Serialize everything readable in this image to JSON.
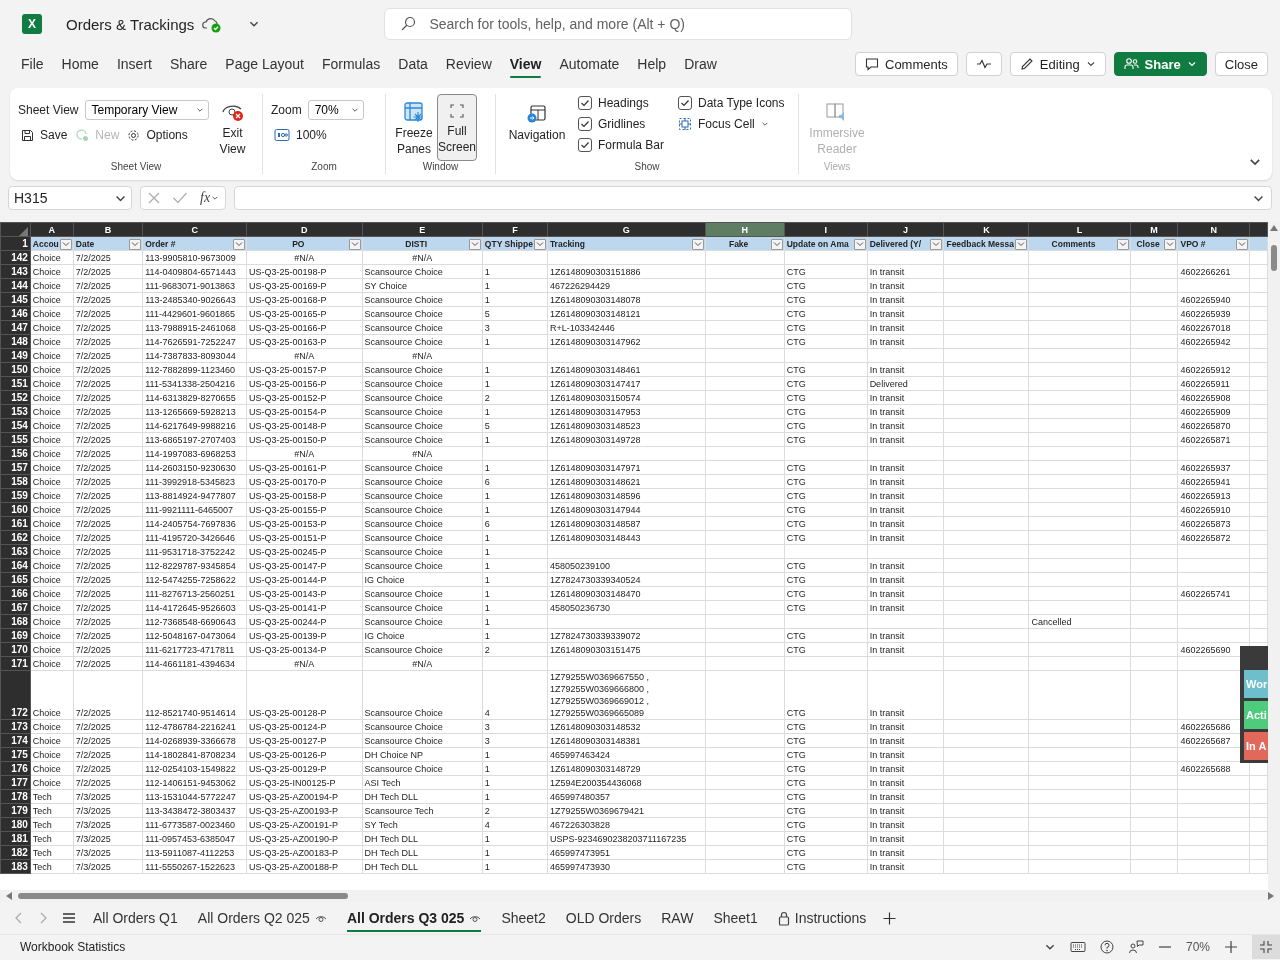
{
  "app": {
    "logo": "X",
    "title": "Orders & Trackings",
    "search": {
      "placeholder": "Search for tools, help, and more (Alt + Q)"
    }
  },
  "menu": [
    {
      "label": "File",
      "selected": false
    },
    {
      "label": "Home",
      "selected": false
    },
    {
      "label": "Insert",
      "selected": false
    },
    {
      "label": "Share",
      "selected": false
    },
    {
      "label": "Page Layout",
      "selected": false
    },
    {
      "label": "Formulas",
      "selected": false
    },
    {
      "label": "Data",
      "selected": false
    },
    {
      "label": "Review",
      "selected": false
    },
    {
      "label": "View",
      "selected": true
    },
    {
      "label": "Automate",
      "selected": false
    },
    {
      "label": "Help",
      "selected": false
    },
    {
      "label": "Draw",
      "selected": false
    }
  ],
  "actions": {
    "comments": "Comments",
    "editing": "Editing",
    "share": "Share",
    "close": "Close"
  },
  "ribbon": {
    "sheet_view": {
      "label": "Sheet View",
      "view": "Temporary View",
      "exit": "Exit View",
      "save": "Save",
      "new": {
        "label": "New",
        "disabled": true
      },
      "options": "Options",
      "group": "Sheet View"
    },
    "zoom": {
      "label": "Zoom",
      "value": "70%",
      "reset": "100%",
      "group": "Zoom"
    },
    "window": {
      "freeze": "Freeze Panes",
      "full_screen": {
        "label": "Full Screen",
        "pressed": true
      },
      "group": "Window"
    },
    "show": {
      "navigation": "Navigation",
      "checks": [
        {
          "label": "Headings",
          "checked": true
        },
        {
          "label": "Gridlines",
          "checked": true
        },
        {
          "label": "Formula Bar",
          "checked": true
        },
        {
          "label": "Data Type Icons",
          "checked": true
        }
      ],
      "focus_cell": "Focus Cell",
      "group": "Show"
    },
    "views": {
      "immersive": {
        "label": "Immersive Reader",
        "disabled": true
      },
      "group": "Views"
    }
  },
  "formula_bar": {
    "name_box": "H315",
    "function_label": "fx"
  },
  "sheet": {
    "header_row": "1",
    "columns": [
      {
        "letter": "A",
        "header": "Accou",
        "selected": false
      },
      {
        "letter": "B",
        "header": "Date",
        "selected": false
      },
      {
        "letter": "C",
        "header": "Order #",
        "selected": false
      },
      {
        "letter": "D",
        "header": "PO",
        "selected": false
      },
      {
        "letter": "E",
        "header": "DISTI",
        "selected": false
      },
      {
        "letter": "F",
        "header": "QTY Shippe",
        "selected": false
      },
      {
        "letter": "G",
        "header": "Tracking",
        "selected": false
      },
      {
        "letter": "H",
        "header": "Fake",
        "selected": true
      },
      {
        "letter": "I",
        "header": "Update on Ama",
        "selected": false
      },
      {
        "letter": "J",
        "header": "Delivered (Y/",
        "selected": false
      },
      {
        "letter": "K",
        "header": "Feedback Messa",
        "selected": false
      },
      {
        "letter": "L",
        "header": "Comments",
        "selected": false
      },
      {
        "letter": "M",
        "header": "Close",
        "selected": false
      },
      {
        "letter": "N",
        "header": "VPO #",
        "selected": false
      }
    ],
    "rows": [
      {
        "row": "142",
        "account": "Choice",
        "date": "7/2/2025",
        "order": "113-9905810-9673009",
        "po": "#N/A",
        "disti": "#N/A",
        "error": true
      },
      {
        "row": "143",
        "account": "Choice",
        "date": "7/2/2025",
        "order": "114-0409804-6571443",
        "po": "US-Q3-25-00198-P",
        "disti": "Scansource Choice",
        "qty": "1",
        "tracking": "1Z6148090303151886",
        "update": "CTG",
        "delivered": "In transit",
        "vpo": "4602266261"
      },
      {
        "row": "144",
        "account": "Choice",
        "date": "7/2/2025",
        "order": "111-9683071-9013863",
        "po": "US-Q3-25-00169-P",
        "disti": "SY Choice",
        "qty": "1",
        "tracking": "467226294429",
        "update": "CTG",
        "delivered": "In transit"
      },
      {
        "row": "145",
        "account": "Choice",
        "date": "7/2/2025",
        "order": "113-2485340-9026643",
        "po": "US-Q3-25-00168-P",
        "disti": "Scansource Choice",
        "qty": "1",
        "tracking": "1Z6148090303148078",
        "update": "CTG",
        "delivered": "In transit",
        "vpo": "4602265940"
      },
      {
        "row": "146",
        "account": "Choice",
        "date": "7/2/2025",
        "order": "111-4429601-9601865",
        "po": "US-Q3-25-00165-P",
        "disti": "Scansource Choice",
        "qty": "5",
        "tracking": "1Z6148090303148121",
        "update": "CTG",
        "delivered": "In transit",
        "vpo": "4602265939"
      },
      {
        "row": "147",
        "account": "Choice",
        "date": "7/2/2025",
        "order": "113-7988915-2461068",
        "po": "US-Q3-25-00166-P",
        "disti": "Scansource Choice",
        "qty": "3",
        "tracking": "R+L-103342446",
        "update": "CTG",
        "delivered": "In transit",
        "vpo": "4602267018"
      },
      {
        "row": "148",
        "account": "Choice",
        "date": "7/2/2025",
        "order": "114-7626591-7252247",
        "po": "US-Q3-25-00163-P",
        "disti": "Scansource Choice",
        "qty": "1",
        "tracking": "1Z6148090303147962",
        "update": "CTG",
        "delivered": "In transit",
        "vpo": "4602265942"
      },
      {
        "row": "149",
        "account": "Choice",
        "date": "7/2/2025",
        "order": "114-7387833-8093044",
        "po": "#N/A",
        "disti": "#N/A",
        "error": true
      },
      {
        "row": "150",
        "account": "Choice",
        "date": "7/2/2025",
        "order": "112-7882899-1123460",
        "po": "US-Q3-25-00157-P",
        "disti": "Scansource Choice",
        "qty": "1",
        "tracking": "1Z6148090303148461",
        "update": "CTG",
        "delivered": "In transit",
        "vpo": "4602265912"
      },
      {
        "row": "151",
        "account": "Choice",
        "date": "7/2/2025",
        "order": "111-5341338-2504216",
        "po": "US-Q3-25-00156-P",
        "disti": "Scansource Choice",
        "qty": "1",
        "tracking": "1Z6148090303147417",
        "update": "CTG",
        "delivered": "Delivered",
        "vpo": "4602265911"
      },
      {
        "row": "152",
        "account": "Choice",
        "date": "7/2/2025",
        "order": "114-6313829-8270655",
        "po": "US-Q3-25-00152-P",
        "disti": "Scansource Choice",
        "qty": "2",
        "tracking": "1Z6148090303150574",
        "update": "CTG",
        "delivered": "In transit",
        "vpo": "4602265908"
      },
      {
        "row": "153",
        "account": "Choice",
        "date": "7/2/2025",
        "order": "113-1265669-5928213",
        "po": "US-Q3-25-00154-P",
        "disti": "Scansource Choice",
        "qty": "1",
        "tracking": "1Z6148090303147953",
        "update": "CTG",
        "delivered": "In transit",
        "vpo": "4602265909"
      },
      {
        "row": "154",
        "account": "Choice",
        "date": "7/2/2025",
        "order": "114-6217649-9988216",
        "po": "US-Q3-25-00148-P",
        "disti": "Scansource Choice",
        "qty": "5",
        "tracking": "1Z6148090303148523",
        "update": "CTG",
        "delivered": "In transit",
        "vpo": "4602265870"
      },
      {
        "row": "155",
        "account": "Choice",
        "date": "7/2/2025",
        "order": "113-6865197-2707403",
        "po": "US-Q3-25-00150-P",
        "disti": "Scansource Choice",
        "qty": "1",
        "tracking": "1Z6148090303149728",
        "update": "CTG",
        "delivered": "In transit",
        "vpo": "4602265871"
      },
      {
        "row": "156",
        "account": "Choice",
        "date": "7/2/2025",
        "order": "114-1997083-6968253",
        "po": "#N/A",
        "disti": "#N/A",
        "error": true
      },
      {
        "row": "157",
        "account": "Choice",
        "date": "7/2/2025",
        "order": "114-2603150-9230630",
        "po": "US-Q3-25-00161-P",
        "disti": "Scansource Choice",
        "qty": "1",
        "tracking": "1Z6148090303147971",
        "update": "CTG",
        "delivered": "In transit",
        "vpo": "4602265937"
      },
      {
        "row": "158",
        "account": "Choice",
        "date": "7/2/2025",
        "order": "111-3992918-5345823",
        "po": "US-Q3-25-00170-P",
        "disti": "Scansource Choice",
        "qty": "6",
        "tracking": "1Z6148090303148621",
        "update": "CTG",
        "delivered": "In transit",
        "vpo": "4602265941"
      },
      {
        "row": "159",
        "account": "Choice",
        "date": "7/2/2025",
        "order": "113-8814924-9477807",
        "po": "US-Q3-25-00158-P",
        "disti": "Scansource Choice",
        "qty": "1",
        "tracking": "1Z6148090303148596",
        "update": "CTG",
        "delivered": "In transit",
        "vpo": "4602265913"
      },
      {
        "row": "160",
        "account": "Choice",
        "date": "7/2/2025",
        "order": "111-9921111-6465007",
        "po": "US-Q3-25-00155-P",
        "disti": "Scansource Choice",
        "qty": "1",
        "tracking": "1Z6148090303147944",
        "update": "CTG",
        "delivered": "In transit",
        "vpo": "4602265910"
      },
      {
        "row": "161",
        "account": "Choice",
        "date": "7/2/2025",
        "order": "114-2405754-7697836",
        "po": "US-Q3-25-00153-P",
        "disti": "Scansource Choice",
        "qty": "6",
        "tracking": "1Z6148090303148587",
        "update": "CTG",
        "delivered": "In transit",
        "vpo": "4602265873"
      },
      {
        "row": "162",
        "account": "Choice",
        "date": "7/2/2025",
        "order": "111-4195720-3426646",
        "po": "US-Q3-25-00151-P",
        "disti": "Scansource Choice",
        "qty": "1",
        "tracking": "1Z6148090303148443",
        "update": "CTG",
        "delivered": "In transit",
        "vpo": "4602265872"
      },
      {
        "row": "163",
        "account": "Choice",
        "date": "7/2/2025",
        "order": "111-9531718-3752242",
        "po": "US-Q3-25-00245-P",
        "disti": "Scansource Choice",
        "qty": "1"
      },
      {
        "row": "164",
        "account": "Choice",
        "date": "7/2/2025",
        "order": "112-8229787-9345854",
        "po": "US-Q3-25-00147-P",
        "disti": "Scansource Choice",
        "qty": "1",
        "tracking": "458050239100",
        "update": "CTG",
        "delivered": "In transit"
      },
      {
        "row": "165",
        "account": "Choice",
        "date": "7/2/2025",
        "order": "112-5474255-7258622",
        "po": "US-Q3-25-00144-P",
        "disti": "IG Choice",
        "qty": "1",
        "tracking": "1Z7824730339340524",
        "update": "CTG",
        "delivered": "In transit"
      },
      {
        "row": "166",
        "account": "Choice",
        "date": "7/2/2025",
        "order": "111-8276713-2560251",
        "po": "US-Q3-25-00143-P",
        "disti": "Scansource Choice",
        "qty": "1",
        "tracking": "1Z6148090303148470",
        "update": "CTG",
        "delivered": "In transit",
        "vpo": "4602265741"
      },
      {
        "row": "167",
        "account": "Choice",
        "date": "7/2/2025",
        "order": "114-4172645-9526603",
        "po": "US-Q3-25-00141-P",
        "disti": "Scansource Choice",
        "qty": "1",
        "tracking": "458050236730",
        "update": "CTG",
        "delivered": "In transit"
      },
      {
        "row": "168",
        "account": "Choice",
        "date": "7/2/2025",
        "order": "112-7368548-6690643",
        "po": "US-Q3-25-00244-P",
        "disti": "Scansource Choice",
        "qty": "1",
        "comments": "Cancelled"
      },
      {
        "row": "169",
        "account": "Choice",
        "date": "7/2/2025",
        "order": "112-5048167-0473064",
        "po": "US-Q3-25-00139-P",
        "disti": "IG Choice",
        "qty": "1",
        "tracking": "1Z7824730339339072",
        "update": "CTG",
        "delivered": "In transit"
      },
      {
        "row": "170",
        "account": "Choice",
        "date": "7/2/2025",
        "order": "111-6217723-4717811",
        "po": "US-Q3-25-00134-P",
        "disti": "Scansource Choice",
        "qty": "2",
        "tracking": "1Z6148090303151475",
        "update": "CTG",
        "delivered": "In transit",
        "vpo": "4602265690"
      },
      {
        "row": "171",
        "account": "Choice",
        "date": "7/2/2025",
        "order": "114-4661181-4394634",
        "po": "#N/A",
        "disti": "#N/A",
        "error": true
      },
      {
        "row": "172",
        "account": "Choice",
        "date": "7/2/2025",
        "order": "112-8521740-9514614",
        "po": "US-Q3-25-00128-P",
        "disti": "Scansource Choice",
        "qty": "4",
        "tracking": "1Z79255W0369667550 ,\n1Z79255W0369666800 ,\n1Z79255W0369669012 ,\n1Z79255W0369665089",
        "update": "CTG",
        "delivered": "In transit"
      },
      {
        "row": "173",
        "account": "Choice",
        "date": "7/2/2025",
        "order": "112-4786784-2216241",
        "po": "US-Q3-25-00124-P",
        "disti": "Scansource Choice",
        "qty": "3",
        "tracking": "1Z6148090303148532",
        "update": "CTG",
        "delivered": "In transit",
        "vpo": "4602265686"
      },
      {
        "row": "174",
        "account": "Choice",
        "date": "7/2/2025",
        "order": "114-0268939-3366678",
        "po": "US-Q3-25-00127-P",
        "disti": "Scansource Choice",
        "qty": "3",
        "tracking": "1Z6148090303148381",
        "update": "CTG",
        "delivered": "In transit",
        "vpo": "4602265687"
      },
      {
        "row": "175",
        "account": "Choice",
        "date": "7/2/2025",
        "order": "114-1802841-8708234",
        "po": "US-Q3-25-00126-P",
        "disti": "DH Choice NP",
        "qty": "1",
        "tracking": "465997463424",
        "update": "CTG",
        "delivered": "In transit"
      },
      {
        "row": "176",
        "account": "Choice",
        "date": "7/2/2025",
        "order": "112-0254103-1549822",
        "po": "US-Q3-25-00129-P",
        "disti": "Scansource Choice",
        "qty": "1",
        "tracking": "1Z6148090303148729",
        "update": "CTG",
        "delivered": "In transit",
        "vpo": "4602265688"
      },
      {
        "row": "177",
        "account": "Choice",
        "date": "7/2/2025",
        "order": "112-1406151-9453062",
        "po": "US-Q3-25-IN00125-P",
        "disti": "ASI Tech",
        "qty": "1",
        "tracking": "1Z594E200354436068",
        "update": "CTG",
        "delivered": "In transit"
      },
      {
        "row": "178",
        "account": "Tech",
        "date": "7/3/2025",
        "order": "113-1531044-5772247",
        "po": "US-Q3-25-AZ00194-P",
        "disti": "DH Tech DLL",
        "qty": "1",
        "tracking": "465997480357",
        "update": "CTG",
        "delivered": "In transit"
      },
      {
        "row": "179",
        "account": "Tech",
        "date": "7/3/2025",
        "order": "113-3438472-3803437",
        "po": "US-Q3-25-AZ00193-P",
        "disti": "Scansource Tech",
        "qty": "2",
        "tracking": "1Z79255W0369679421",
        "update": "CTG",
        "delivered": "In transit"
      },
      {
        "row": "180",
        "account": "Tech",
        "date": "7/3/2025",
        "order": "111-6773587-0023460",
        "po": "US-Q3-25-AZ00191-P",
        "disti": "SY Tech",
        "qty": "4",
        "tracking": "467226303828",
        "update": "CTG",
        "delivered": "In transit"
      },
      {
        "row": "181",
        "account": "Tech",
        "date": "7/3/2025",
        "order": "111-0957453-6385047",
        "po": "US-Q3-25-AZ00190-P",
        "disti": "DH Tech DLL",
        "qty": "1",
        "tracking": "USPS-9234690238203711167235",
        "update": "CTG",
        "delivered": "In transit"
      },
      {
        "row": "182",
        "account": "Tech",
        "date": "7/3/2025",
        "order": "113-5911087-4112253",
        "po": "US-Q3-25-AZ00183-P",
        "disti": "DH Tech DLL",
        "qty": "1",
        "tracking": "465997473951",
        "update": "CTG",
        "delivered": "In transit"
      },
      {
        "row": "183",
        "account": "Tech",
        "date": "7/3/2025",
        "order": "111-5550267-1522623",
        "po": "US-Q3-25-AZ00188-P",
        "disti": "DH Tech DLL",
        "qty": "1",
        "tracking": "465997473930",
        "update": "CTG",
        "delivered": "In transit"
      }
    ]
  },
  "side_panel": [
    {
      "label": "Wor",
      "color": "#6cbfcb"
    },
    {
      "label": "Acti",
      "color": "#4fcb7c"
    },
    {
      "label": "In A",
      "color": "#e2685c"
    }
  ],
  "sheet_tabs": [
    {
      "label": "All Orders Q1",
      "selected": false,
      "kind": "plain"
    },
    {
      "label": "All Orders Q2 025",
      "selected": false,
      "kind": "view"
    },
    {
      "label": "All Orders Q3 025",
      "selected": true,
      "kind": "view"
    },
    {
      "label": "Sheet2",
      "selected": false,
      "kind": "plain"
    },
    {
      "label": "OLD Orders",
      "selected": false,
      "kind": "plain"
    },
    {
      "label": "RAW",
      "selected": false,
      "kind": "plain"
    },
    {
      "label": "Sheet1",
      "selected": false,
      "kind": "plain"
    },
    {
      "label": "Instructions",
      "selected": false,
      "kind": "locked"
    }
  ],
  "status_bar": {
    "label": "Workbook Statistics",
    "zoom": "70%"
  }
}
